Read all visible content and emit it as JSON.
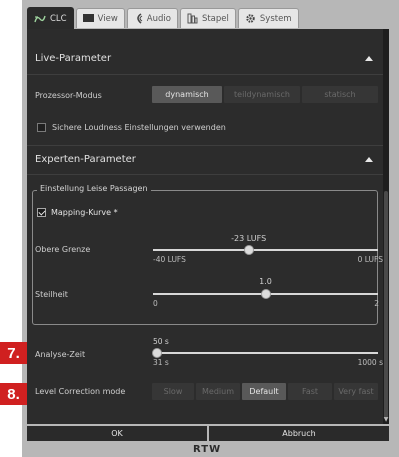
{
  "tabs": [
    {
      "label": "CLC",
      "icon": "clc-icon",
      "active": true
    },
    {
      "label": "View",
      "icon": "monitor-icon",
      "active": false
    },
    {
      "label": "Audio",
      "icon": "audio-icon",
      "active": false
    },
    {
      "label": "Stapel",
      "icon": "stack-icon",
      "active": false
    },
    {
      "label": "System",
      "icon": "gear-icon",
      "active": false
    }
  ],
  "live": {
    "title": "Live-Parameter",
    "processor_label": "Prozessor-Modus",
    "modes": [
      "dynamisch",
      "teildynamisch",
      "statisch"
    ],
    "mode_selected": "dynamisch",
    "safe_loudness_label": "Sichere Loudness Einstellungen verwenden",
    "safe_loudness_checked": false
  },
  "expert": {
    "title": "Experten-Parameter",
    "group_title": "Einstellung Leise Passagen",
    "mapping_label": "Mapping-Kurve *",
    "mapping_checked": true,
    "upper_limit": {
      "label": "Obere Grenze",
      "value_text": "-23 LUFS",
      "value": -23,
      "min": -40,
      "max": 0,
      "min_text": "-40 LUFS",
      "max_text": "0 LUFS"
    },
    "slope": {
      "label": "Steilheit",
      "value_text": "1.0",
      "value": 1.0,
      "min": 0,
      "max": 2,
      "min_text": "0",
      "max_text": "2"
    },
    "analysis_time": {
      "label": "Analyse-Zeit",
      "value_text": "50 s",
      "value": 50,
      "min": 31,
      "max": 1000,
      "min_text": "31 s",
      "max_text": "1000 s"
    },
    "level_correction": {
      "label": "Level Correction mode",
      "options": [
        "Slow",
        "Medium",
        "Default",
        "Fast",
        "Very fast"
      ],
      "selected": "Default"
    }
  },
  "footer": {
    "ok": "OK",
    "cancel": "Abbruch",
    "logo": "RTW"
  },
  "badges": {
    "seven": "7.",
    "eight": "8."
  },
  "colors": {
    "panel": "#2c2c2c",
    "badge": "#d02020",
    "selected": "#595959"
  }
}
